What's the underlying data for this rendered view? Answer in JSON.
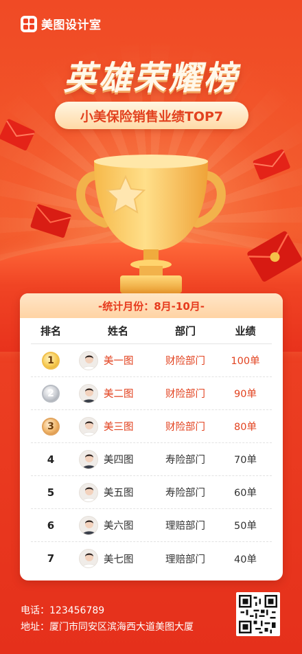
{
  "brand": {
    "name": "美图设计室"
  },
  "title": "英雄荣耀榜",
  "subtitle": "小美保险销售业绩TOP7",
  "period": "-统计月份：8月-10月-",
  "table": {
    "headers": [
      "排名",
      "姓名",
      "部门",
      "业绩"
    ],
    "rows": [
      {
        "rank": "1",
        "name": "美一图",
        "dept": "财险部门",
        "perf": "100单",
        "medal": "gold"
      },
      {
        "rank": "2",
        "name": "美二图",
        "dept": "财险部门",
        "perf": "90单",
        "medal": "silver"
      },
      {
        "rank": "3",
        "name": "美三图",
        "dept": "财险部门",
        "perf": "80单",
        "medal": "bronze"
      },
      {
        "rank": "4",
        "name": "美四图",
        "dept": "寿险部门",
        "perf": "70单"
      },
      {
        "rank": "5",
        "name": "美五图",
        "dept": "寿险部门",
        "perf": "60单"
      },
      {
        "rank": "6",
        "name": "美六图",
        "dept": "理赔部门",
        "perf": "50单"
      },
      {
        "rank": "7",
        "name": "美七图",
        "dept": "理赔部门",
        "perf": "40单"
      }
    ]
  },
  "contact": {
    "phone_label": "电话：",
    "phone": "123456789",
    "address_label": "地址：",
    "address": "厦门市同安区滨海西大道美图大厦"
  },
  "colors": {
    "background": "#e8321c",
    "accent": "#e2421f",
    "gold": "#f7cc55",
    "header_band": "#ffd9a6"
  },
  "icons": [
    "logo-icon",
    "trophy-icon",
    "star-icon",
    "gold-medal-icon",
    "silver-medal-icon",
    "bronze-medal-icon",
    "avatar-icon",
    "qr-code-icon",
    "red-packet-icon"
  ]
}
